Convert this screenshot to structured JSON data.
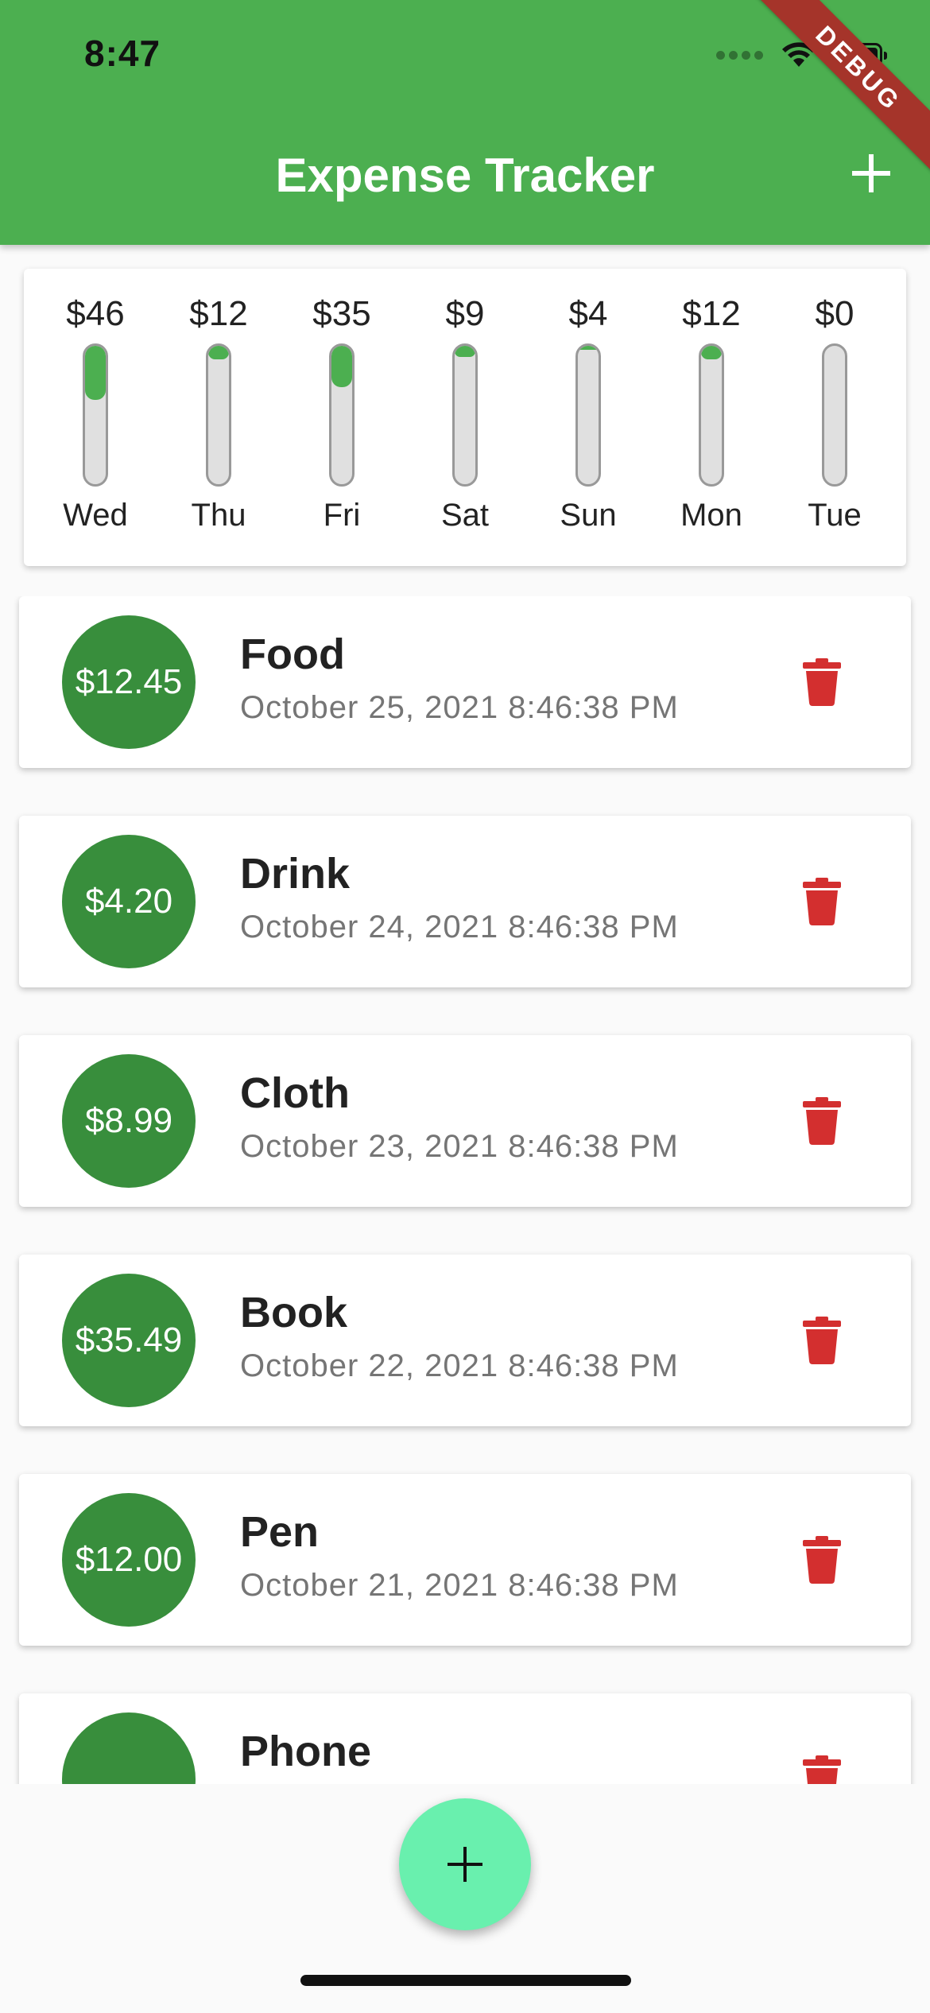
{
  "status_bar": {
    "time": "8:47",
    "icons": [
      "signal-dots-icon",
      "wifi-icon",
      "battery-icon"
    ]
  },
  "app_bar": {
    "title": "Expense Tracker",
    "action_icon": "plus-icon",
    "background": "#4caf50"
  },
  "debug_banner": "DEBUG",
  "chart": {
    "bars": [
      {
        "amount": "$46",
        "day": "Wed",
        "fill": 0.39
      },
      {
        "amount": "$12",
        "day": "Thu",
        "fill": 0.1
      },
      {
        "amount": "$35",
        "day": "Fri",
        "fill": 0.3
      },
      {
        "amount": "$9",
        "day": "Sat",
        "fill": 0.08
      },
      {
        "amount": "$4",
        "day": "Sun",
        "fill": 0.03
      },
      {
        "amount": "$12",
        "day": "Mon",
        "fill": 0.1
      },
      {
        "amount": "$0",
        "day": "Tue",
        "fill": 0.0
      }
    ],
    "fill_color": "#4caf50"
  },
  "transactions": [
    {
      "amount": "$12.45",
      "title": "Food",
      "date": "October 25, 2021 8:46:38 PM"
    },
    {
      "amount": "$4.20",
      "title": "Drink",
      "date": "October 24, 2021 8:46:38 PM"
    },
    {
      "amount": "$8.99",
      "title": "Cloth",
      "date": "October 23, 2021 8:46:38 PM"
    },
    {
      "amount": "$35.49",
      "title": "Book",
      "date": "October 22, 2021 8:46:38 PM"
    },
    {
      "amount": "$12.00",
      "title": "Pen",
      "date": "October 21, 2021 8:46:38 PM"
    },
    {
      "amount": "",
      "title": "Phone",
      "date": ""
    }
  ],
  "colors": {
    "avatar": "#388e3c",
    "delete": "#d32f2f",
    "fab": "#69f0ae"
  },
  "fab_icon": "plus-icon"
}
